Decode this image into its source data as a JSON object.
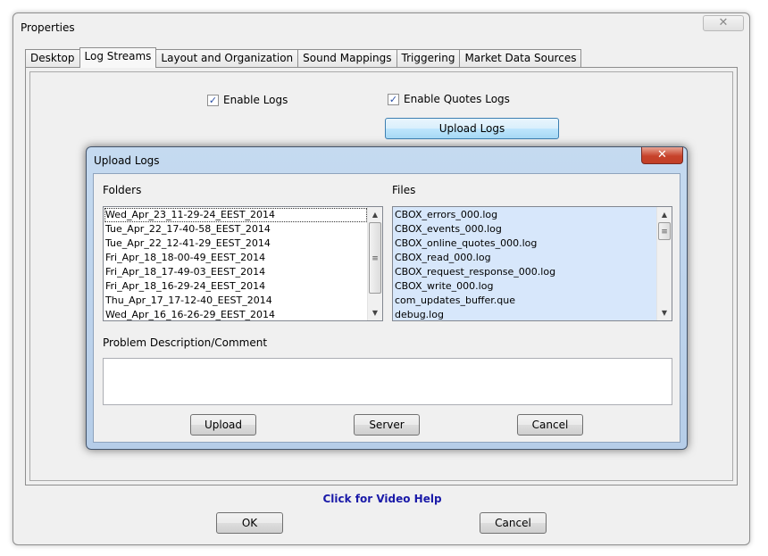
{
  "window": {
    "title": "Properties",
    "close_glyph": "✕"
  },
  "tabs": [
    {
      "label": "Desktop"
    },
    {
      "label": "Log Streams",
      "active": true
    },
    {
      "label": "Layout and Organization"
    },
    {
      "label": "Sound Mappings"
    },
    {
      "label": "Triggering"
    },
    {
      "label": "Market Data Sources"
    }
  ],
  "log_streams": {
    "enable_logs_label": "Enable Logs",
    "enable_logs_checked": true,
    "enable_quotes_logs_label": "Enable Quotes Logs",
    "enable_quotes_logs_checked": true,
    "upload_logs_button": "Upload Logs",
    "check_glyph": "✓"
  },
  "upload_dialog": {
    "title": "Upload Logs",
    "close_glyph": "✕",
    "folders_label": "Folders",
    "files_label": "Files",
    "folders": [
      "Wed_Apr_23_11-29-24_EEST_2014",
      "Tue_Apr_22_17-40-58_EEST_2014",
      "Tue_Apr_22_12-41-29_EEST_2014",
      "Fri_Apr_18_18-00-49_EEST_2014",
      "Fri_Apr_18_17-49-03_EEST_2014",
      "Fri_Apr_18_16-29-24_EEST_2014",
      "Thu_Apr_17_17-12-40_EEST_2014",
      "Wed_Apr_16_16-26-29_EEST_2014"
    ],
    "files": [
      "CBOX_errors_000.log",
      "CBOX_events_000.log",
      "CBOX_online_quotes_000.log",
      "CBOX_read_000.log",
      "CBOX_request_response_000.log",
      "CBOX_write_000.log",
      "com_updates_buffer.que",
      "debug.log"
    ],
    "comment_label": "Problem Description/Comment",
    "comment_value": "",
    "upload_button": "Upload",
    "server_button": "Server",
    "cancel_button": "Cancel"
  },
  "footer": {
    "help_link": "Click for Video Help",
    "ok_button": "OK",
    "cancel_button": "Cancel"
  }
}
